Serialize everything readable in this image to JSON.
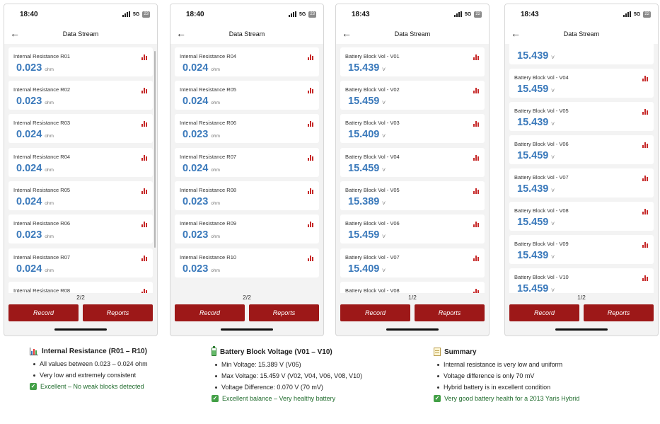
{
  "phones": [
    {
      "time": "18:40",
      "network": "5G",
      "battery": "23",
      "back_icon": "arrow-left-icon",
      "title": "Data Stream",
      "pager": "2/2",
      "record_label": "Record",
      "reports_label": "Reports",
      "items": [
        {
          "label": "Internal Resistance R01",
          "value": "0.023",
          "unit": "ohm"
        },
        {
          "label": "Internal Resistance R02",
          "value": "0.023",
          "unit": "ohm"
        },
        {
          "label": "Internal Resistance R03",
          "value": "0.024",
          "unit": "ohm"
        },
        {
          "label": "Internal Resistance R04",
          "value": "0.024",
          "unit": "ohm"
        },
        {
          "label": "Internal Resistance R05",
          "value": "0.024",
          "unit": "ohm"
        },
        {
          "label": "Internal Resistance R06",
          "value": "0.023",
          "unit": "ohm"
        },
        {
          "label": "Internal Resistance R07",
          "value": "0.024",
          "unit": "ohm"
        },
        {
          "label": "Internal Resistance R08",
          "value": "",
          "unit": ""
        }
      ]
    },
    {
      "time": "18:40",
      "network": "5G",
      "battery": "23",
      "back_icon": "arrow-left-icon",
      "title": "Data Stream",
      "pager": "2/2",
      "record_label": "Record",
      "reports_label": "Reports",
      "items": [
        {
          "label": "Internal Resistance R04",
          "value": "0.024",
          "unit": "ohm"
        },
        {
          "label": "Internal Resistance R05",
          "value": "0.024",
          "unit": "ohm"
        },
        {
          "label": "Internal Resistance R06",
          "value": "0.023",
          "unit": "ohm"
        },
        {
          "label": "Internal Resistance R07",
          "value": "0.024",
          "unit": "ohm"
        },
        {
          "label": "Internal Resistance R08",
          "value": "0.023",
          "unit": "ohm"
        },
        {
          "label": "Internal Resistance R09",
          "value": "0.023",
          "unit": "ohm"
        },
        {
          "label": "Internal Resistance R10",
          "value": "0.023",
          "unit": "ohm"
        }
      ]
    },
    {
      "time": "18:43",
      "network": "5G",
      "battery": "22",
      "back_icon": "arrow-left-icon",
      "title": "Data Stream",
      "pager": "1/2",
      "record_label": "Record",
      "reports_label": "Reports",
      "items": [
        {
          "label": "Battery Block Vol - V01",
          "value": "15.439",
          "unit": "V"
        },
        {
          "label": "Battery Block Vol - V02",
          "value": "15.459",
          "unit": "V"
        },
        {
          "label": "Battery Block Vol - V03",
          "value": "15.409",
          "unit": "V"
        },
        {
          "label": "Battery Block Vol - V04",
          "value": "15.459",
          "unit": "V"
        },
        {
          "label": "Battery Block Vol - V05",
          "value": "15.389",
          "unit": "V"
        },
        {
          "label": "Battery Block Vol - V06",
          "value": "15.459",
          "unit": "V"
        },
        {
          "label": "Battery Block Vol - V07",
          "value": "15.409",
          "unit": "V"
        },
        {
          "label": "Battery Block Vol - V08",
          "value": "",
          "unit": ""
        }
      ]
    },
    {
      "time": "18:43",
      "network": "5G",
      "battery": "22",
      "back_icon": "arrow-left-icon",
      "title": "Data Stream",
      "pager": "1/2",
      "record_label": "Record",
      "reports_label": "Reports",
      "items": [
        {
          "label": "",
          "value": "15.439",
          "unit": "V"
        },
        {
          "label": "Battery Block Vol - V04",
          "value": "15.459",
          "unit": "V"
        },
        {
          "label": "Battery Block Vol - V05",
          "value": "15.439",
          "unit": "V"
        },
        {
          "label": "Battery Block Vol - V06",
          "value": "15.459",
          "unit": "V"
        },
        {
          "label": "Battery Block Vol - V07",
          "value": "15.439",
          "unit": "V"
        },
        {
          "label": "Battery Block Vol - V08",
          "value": "15.459",
          "unit": "V"
        },
        {
          "label": "Battery Block Vol - V09",
          "value": "15.439",
          "unit": "V"
        },
        {
          "label": "Battery Block Vol - V10",
          "value": "15.459",
          "unit": "V"
        }
      ]
    }
  ],
  "summaries": [
    {
      "icon": "bar-chart-icon",
      "title": "Internal Resistance (R01 – R10)",
      "bullets": [
        "All values between 0.023 – 0.024 ohm",
        "Very low and extremely consistent"
      ],
      "verdict": "Excellent – No weak blocks detected"
    },
    {
      "icon": "battery-icon",
      "title": "Battery Block Voltage (V01 – V10)",
      "bullets": [
        "Min Voltage: 15.389 V (V05)",
        "Max Voltage: 15.459 V (V02, V04, V06, V08, V10)",
        "Voltage Difference: 0.070 V (70 mV)"
      ],
      "verdict": "Excellent balance – Very healthy battery"
    },
    {
      "icon": "memo-icon",
      "title": "Summary",
      "bullets": [
        "Internal resistance is very low and uniform",
        "Voltage difference is only 70 mV",
        "Hybrid battery is in excellent condition"
      ],
      "verdict": "Very good battery health for a 2013 Yaris Hybrid"
    }
  ],
  "colors": {
    "accent_red": "#9d1818",
    "value_blue": "#3a79bb",
    "check_green": "#43a047"
  }
}
